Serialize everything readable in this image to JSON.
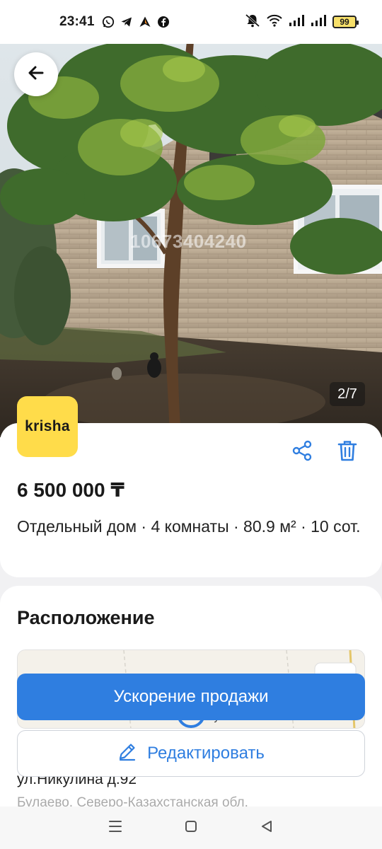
{
  "status_bar": {
    "time": "23:41",
    "app_icons": [
      "whatsapp-icon",
      "telegram-icon",
      "navigation-app-icon",
      "facebook-icon"
    ],
    "battery_level": "99"
  },
  "photo": {
    "counter": "2/7",
    "watermark": "10673404240"
  },
  "listing": {
    "logo_text": "krisha",
    "price": "6 500 000 ₸",
    "description": "Отдельный дом · 4 комнаты · 80.9 м² · 10 сот."
  },
  "location": {
    "title": "Расположение",
    "map_label": "Булаево",
    "address": "ул.Никулина д.92",
    "address_sub": "Булаево, Северо-Казахстанская обл."
  },
  "actions": {
    "boost_label": "Ускорение продажи",
    "edit_label": "Редактировать"
  },
  "colors": {
    "accent": "#2f7ee0",
    "logo_bg": "#ffdc4a"
  }
}
